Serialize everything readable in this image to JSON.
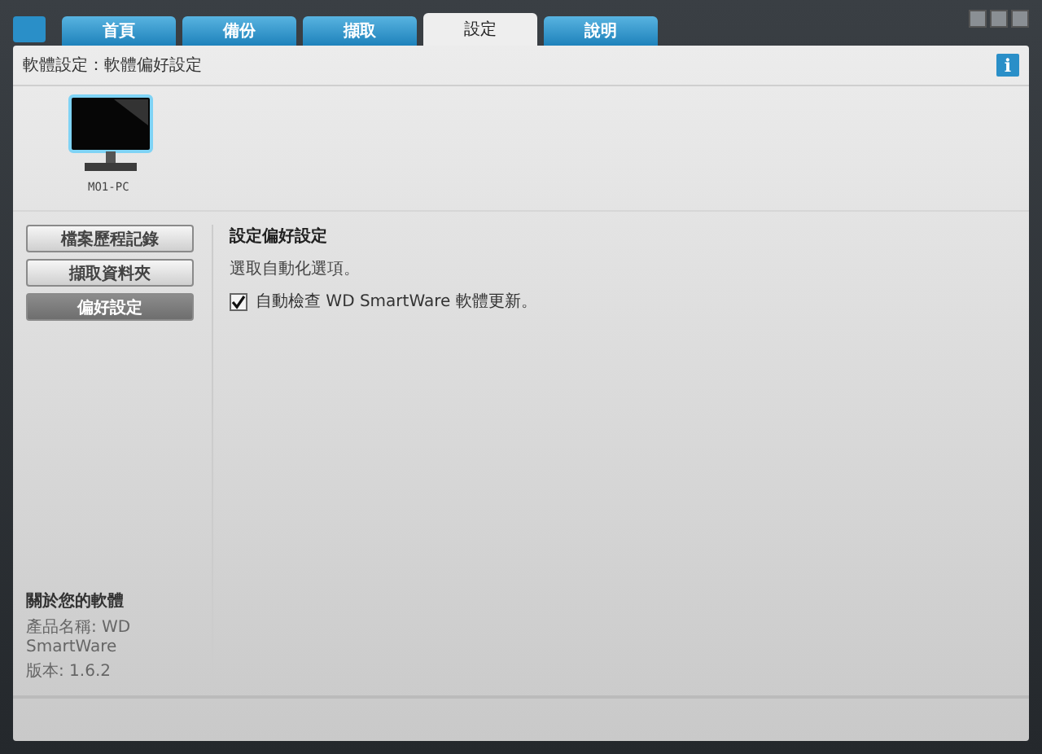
{
  "tabs": [
    {
      "label": "首頁",
      "selected": false
    },
    {
      "label": "備份",
      "selected": false
    },
    {
      "label": "擷取",
      "selected": false
    },
    {
      "label": "設定",
      "selected": true
    },
    {
      "label": "說明",
      "selected": false
    }
  ],
  "header": {
    "title": "軟體設定：軟體偏好設定",
    "info_icon": "i"
  },
  "device": {
    "name": "MO1-PC"
  },
  "sidebar": {
    "items": [
      {
        "label": "檔案歷程記錄",
        "selected": false
      },
      {
        "label": "擷取資料夾",
        "selected": false
      },
      {
        "label": "偏好設定",
        "selected": true
      }
    ],
    "about": {
      "title": "關於您的軟體",
      "product": "產品名稱: WD SmartWare",
      "version": "版本: 1.6.2"
    }
  },
  "content": {
    "title": "設定偏好設定",
    "description": "選取自動化選項。",
    "options": [
      {
        "label": "自動檢查 WD SmartWare 軟體更新。",
        "checked": true
      }
    ]
  }
}
